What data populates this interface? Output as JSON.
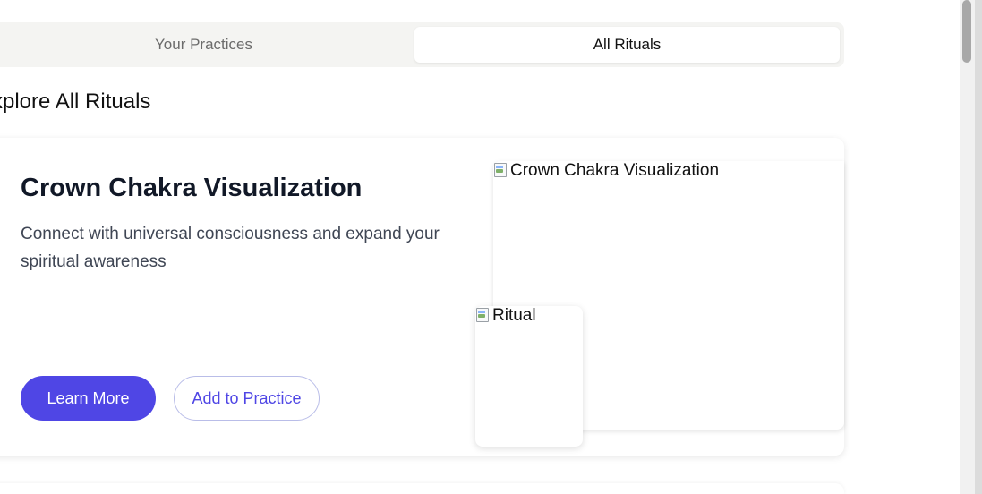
{
  "tabs": [
    {
      "label": "Your Practices",
      "active": false
    },
    {
      "label": "All Rituals",
      "active": true
    }
  ],
  "section": {
    "title": "xplore All Rituals"
  },
  "card": {
    "title": "Crown Chakra Visualization",
    "description": "Connect with universal consciousness and expand your spiritual awareness",
    "primary_button": "Learn More",
    "secondary_button": "Add to Practice",
    "main_image_alt": "Crown Chakra Visualization",
    "small_image_alt": "Ritual"
  },
  "colors": {
    "accent": "#4f46e5",
    "tab_bar_bg": "#f4f4f2",
    "secondary_border": "#b9bde8"
  },
  "icons": {
    "broken_image": "broken-image-icon"
  }
}
